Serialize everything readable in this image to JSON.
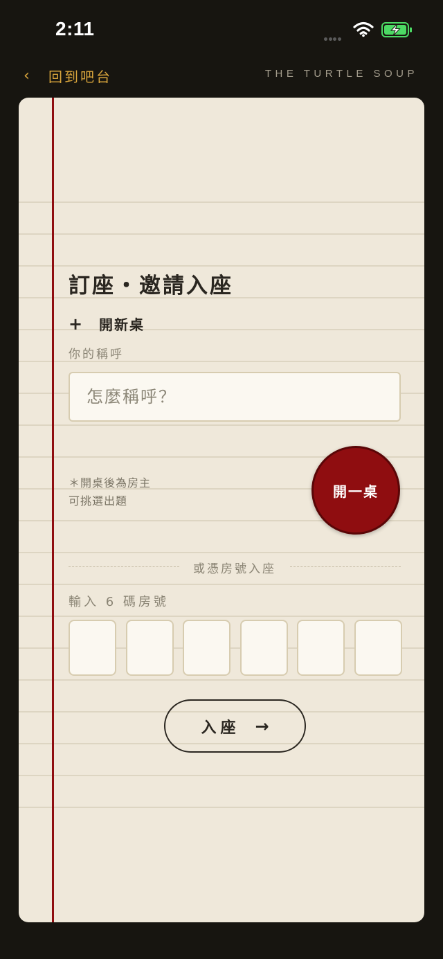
{
  "status_bar": {
    "time": "2:11"
  },
  "nav": {
    "back_label": "回到吧台",
    "brand": "THE TURTLE SOUP"
  },
  "card": {
    "title": "訂座・邀請入座",
    "new_table_label": "開新桌",
    "nickname_label": "你的稱呼",
    "nickname_placeholder": "怎麼稱呼？",
    "nickname_value": "",
    "host_note_line1": "＊開桌後為房主",
    "host_note_line2": "可挑選出題",
    "open_table_button": "開一桌",
    "divider_text": "或憑房號入座",
    "room_code_label": "輸入 6 碼房號",
    "room_code_digits": [
      "",
      "",
      "",
      "",
      "",
      ""
    ],
    "enter_button": "入座"
  },
  "colors": {
    "background": "#171510",
    "card": "#efe8da",
    "accent_red": "#8f0d10",
    "accent_gold": "#d9a53c",
    "battery_green": "#4cd964"
  },
  "icons": {
    "back": "chevron-left-icon",
    "add": "plus-icon",
    "enter": "arrow-right-icon",
    "wifi": "wifi-icon",
    "battery": "battery-charging-icon",
    "signal": "cellular-signal-icon"
  }
}
